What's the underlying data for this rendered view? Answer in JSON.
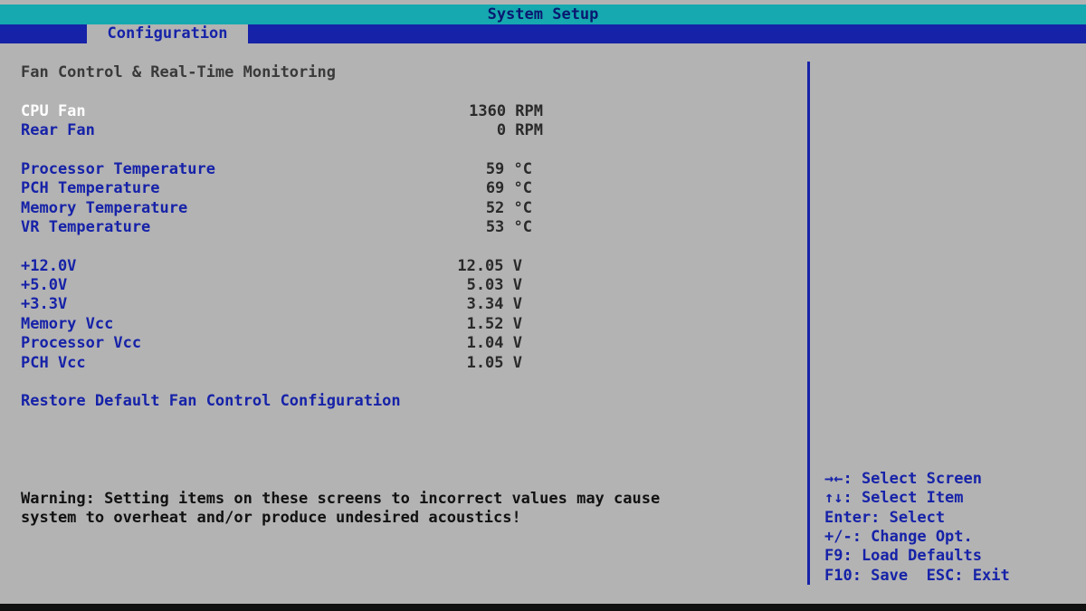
{
  "app": {
    "title": "System Setup"
  },
  "tabs": [
    {
      "label": "Configuration"
    }
  ],
  "section": {
    "heading": "Fan Control & Real-Time Monitoring"
  },
  "fans": [
    {
      "label": "CPU Fan",
      "value": "1360 RPM"
    },
    {
      "label": "Rear Fan",
      "value": "0 RPM"
    }
  ],
  "temperatures": [
    {
      "label": "Processor Temperature",
      "value": "59 °C"
    },
    {
      "label": "PCH Temperature",
      "value": "69 °C"
    },
    {
      "label": "Memory Temperature",
      "value": "52 °C"
    },
    {
      "label": "VR Temperature",
      "value": "53 °C"
    }
  ],
  "voltages": [
    {
      "label": "+12.0V",
      "value": "12.05 V"
    },
    {
      "label": "+5.0V",
      "value": "5.03 V"
    },
    {
      "label": "+3.3V",
      "value": "3.34 V"
    },
    {
      "label": "Memory Vcc",
      "value": "1.52 V"
    },
    {
      "label": "Processor Vcc",
      "value": "1.04 V"
    },
    {
      "label": "PCH Vcc",
      "value": "1.05 V"
    }
  ],
  "restore": {
    "label": "Restore Default Fan Control Configuration"
  },
  "warning": {
    "line1": "Warning: Setting items on these screens to incorrect values may cause",
    "line2": "system to overheat and/or produce undesired acoustics!"
  },
  "help": [
    "→←: Select Screen",
    "↑↓: Select Item",
    "Enter: Select",
    "+/-: Change Opt.",
    "F9: Load Defaults",
    "F10: Save  ESC: Exit"
  ],
  "colors": {
    "background": "#b3b3b3",
    "titlebar": "#16a9b0",
    "accent": "#1622a8",
    "selected": "#ffffff"
  }
}
